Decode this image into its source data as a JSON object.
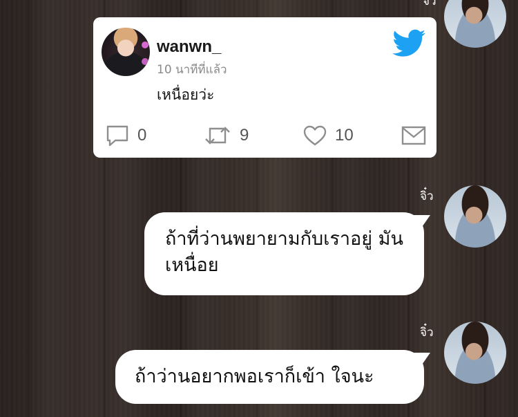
{
  "tweet": {
    "username": "wanwn_",
    "time": "10 นาทีที่แล้ว",
    "text": "เหนื่อยว่ะ",
    "replies": "0",
    "retweets": "9",
    "likes": "10",
    "bird_color": "#1da1f2"
  },
  "messages": [
    {
      "sender": "จิ๋ว",
      "text": ""
    },
    {
      "sender": "จิ๋ว",
      "text": "ถ้าที่ว่านพยายามกับเราอยู่ มันเหนื่อย"
    },
    {
      "sender": "จิ๋ว",
      "text": "ถ้าว่านอยากพอเราก็เข้า ใจนะ"
    }
  ]
}
